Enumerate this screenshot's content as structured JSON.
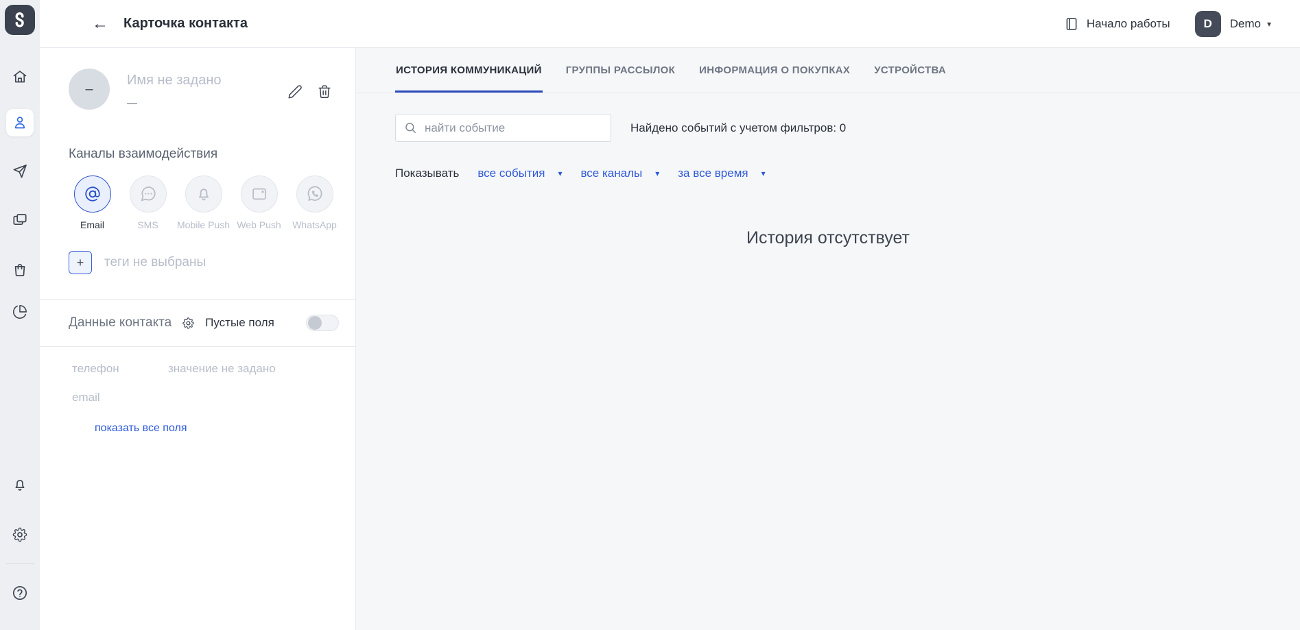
{
  "header": {
    "back_icon": "←",
    "title": "Карточка контакта",
    "getting_started_label": "Начало работы",
    "user_initial": "D",
    "user_name": "Demo",
    "user_caret": "▾"
  },
  "sidebar": {
    "items": [
      {
        "name": "home",
        "icon": "home-icon",
        "active": false
      },
      {
        "name": "contacts",
        "icon": "person-icon",
        "active": true
      },
      {
        "name": "campaigns",
        "icon": "paper-plane-icon",
        "active": false
      },
      {
        "name": "scenarios",
        "icon": "overlapping-windows-icon",
        "active": false
      },
      {
        "name": "products",
        "icon": "shopping-bag-icon",
        "active": false
      },
      {
        "name": "analytics",
        "icon": "pie-chart-icon",
        "active": false
      }
    ],
    "bottom_items": [
      {
        "name": "notifications",
        "icon": "bell-icon"
      },
      {
        "name": "settings",
        "icon": "gear-icon"
      },
      {
        "name": "help",
        "icon": "question-circle-icon"
      }
    ]
  },
  "contact": {
    "avatar_placeholder": "–",
    "name_placeholder": "Имя не задано",
    "secondary_placeholder": "—",
    "channels": {
      "title": "Каналы взаимодействия",
      "items": [
        {
          "label": "Email",
          "icon": "at-sign-icon",
          "active": true
        },
        {
          "label": "SMS",
          "icon": "chat-bubble-icon",
          "active": false
        },
        {
          "label": "Mobile Push",
          "icon": "bell-icon",
          "active": false
        },
        {
          "label": "Web Push",
          "icon": "browser-window-icon",
          "active": false
        },
        {
          "label": "WhatsApp",
          "icon": "whatsapp-icon",
          "active": false
        }
      ]
    },
    "tags": {
      "add_label": "+",
      "placeholder": "теги не выбраны"
    },
    "data_section": {
      "title": "Данные контакта",
      "empty_fields_toggle_label": "Пустые поля",
      "toggle_state": "off",
      "fields": [
        {
          "name": "телефон",
          "value": "значение не задано"
        },
        {
          "name": "email",
          "value": ""
        }
      ],
      "show_all_link": "показать все поля"
    }
  },
  "main": {
    "tabs": [
      {
        "label": "ИСТОРИЯ КОММУНИКАЦИЙ",
        "active": true
      },
      {
        "label": "ГРУППЫ РАССЫЛОК",
        "active": false
      },
      {
        "label": "ИНФОРМАЦИЯ О ПОКУПКАХ",
        "active": false
      },
      {
        "label": "УСТРОЙСТВА",
        "active": false
      }
    ],
    "search": {
      "placeholder": "найти событие"
    },
    "results_summary": "Найдено событий с учетом фильтров: 0",
    "filters": {
      "label": "Показывать",
      "caret_icon": "▾",
      "dropdowns": [
        {
          "value": "все события"
        },
        {
          "value": "все каналы"
        },
        {
          "value": "за все время"
        }
      ]
    },
    "empty_state": "История отсутствует"
  },
  "colors": {
    "accent_blue": "#2e5ad8",
    "tab_underline": "#2b49ba",
    "active_icon_blue": "#2f6ae8",
    "rail_background": "#edeff3",
    "logo_background": "#3b414e",
    "main_background": "#f6f7f9",
    "placeholder_gray": "#b7bdc9",
    "dark_text": "#2c323c"
  }
}
